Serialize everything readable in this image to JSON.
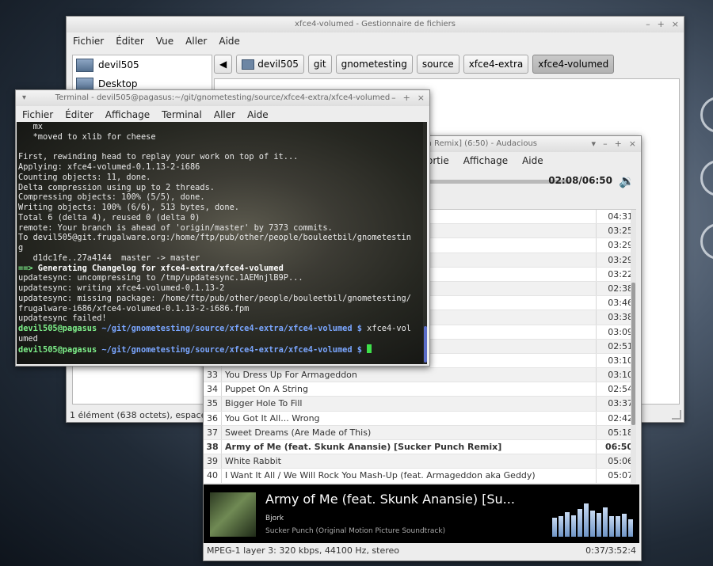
{
  "file_manager": {
    "title": "xfce4-volumed - Gestionnaire de fichiers",
    "menu": [
      "Fichier",
      "Éditer",
      "Vue",
      "Aller",
      "Aide"
    ],
    "side_items": [
      "devil505",
      "Desktop"
    ],
    "path": [
      "devil505",
      "git",
      "gnometesting",
      "source",
      "xfce4-extra",
      "xfce4-volumed"
    ],
    "status": "1 élément (638 octets), espace lib"
  },
  "terminal": {
    "title": "Terminal - devil505@pagasus:~/git/gnometesting/source/xfce4-extra/xfce4-volumed",
    "menu": [
      "Fichier",
      "Éditer",
      "Affichage",
      "Terminal",
      "Aller",
      "Aide"
    ],
    "lines": {
      "l1": "   mx",
      "l2": "   *moved to xlib for cheese",
      "l3": "",
      "l4": "First, rewinding head to replay your work on top of it...",
      "l5": "Applying: xfce4-volumed-0.1.13-2-i686",
      "l6": "Counting objects: 11, done.",
      "l7": "Delta compression using up to 2 threads.",
      "l8": "Compressing objects: 100% (5/5), done.",
      "l9": "Writing objects: 100% (6/6), 513 bytes, done.",
      "l10": "Total 6 (delta 4), reused 0 (delta 0)",
      "l11": "remote: Your branch is ahead of 'origin/master' by 7373 commits.",
      "l12": "To devil505@git.frugalware.org:/home/ftp/pub/other/people/bouleetbil/gnometestin",
      "l13": "g",
      "l14": "   d1dc1fe..27a4144  master -> master",
      "l15_arrow": "==>",
      "l15_text": " Generating Changelog for xfce4-extra/xfce4-volumed",
      "l16": "updatesync: uncompressing to /tmp/updatesync.1AEMnjlB9P...",
      "l17": "updatesync: writing xfce4-volumed-0.1.13-2",
      "l18": "updatesync: missing package: /home/ftp/pub/other/people/bouleetbil/gnometesting/",
      "l19": "frugalware-i686/xfce4-volumed-0.1.13-2-i686.fpm",
      "l20": "updatesync failed!",
      "p1_user": "devil505@pagasus",
      "p1_path": " ~/git/gnometesting/source/xfce4-extra/xfce4-volumed $",
      "p1_cmd": " xfce4-vol",
      "l22": "umed",
      "p2_user": "devil505@pagasus",
      "p2_path": " ~/git/gnometesting/source/xfce4-extra/xfce4-volumed $"
    }
  },
  "audacious": {
    "title": "ch Remix] (6:50) - Audacious",
    "menu": [
      "ortie",
      "Affichage",
      "Aide"
    ],
    "time": "02:08/06:50",
    "seek_fraction": 0.31,
    "hidden_durations": [
      "04:31",
      "03:25",
      "03:29",
      "03:29",
      "03:22",
      "02:38",
      "03:46",
      "03:38",
      "03:09",
      "02:51",
      "03:10"
    ],
    "playlist": [
      {
        "n": "33",
        "title": "You Dress Up For Armageddon",
        "dur": "03:10"
      },
      {
        "n": "34",
        "title": "Puppet On A String",
        "dur": "02:54"
      },
      {
        "n": "35",
        "title": "Bigger Hole To Fill",
        "dur": "03:37"
      },
      {
        "n": "36",
        "title": "You Got It All... Wrong",
        "dur": "02:42"
      },
      {
        "n": "37",
        "title": "Sweet Dreams (Are Made of This)",
        "dur": "05:18"
      },
      {
        "n": "38",
        "title": "Army of Me (feat. Skunk Anansie) [Sucker Punch Remix]",
        "dur": "06:50"
      },
      {
        "n": "39",
        "title": "White Rabbit",
        "dur": "05:06"
      },
      {
        "n": "40",
        "title": "I Want It All / We Will Rock You Mash-Up (feat. Armageddon aka Geddy)",
        "dur": "05:07"
      }
    ],
    "now_playing": {
      "title": "Army of Me (feat. Skunk Anansie) [Su...",
      "artist": "Bjork",
      "album": "Sucker Punch (Original Motion Picture Soundtrack)"
    },
    "status_left": "MPEG-1 layer 3: 320 kbps, 44100 Hz, stereo",
    "status_right": "0:37/3:52:4",
    "visualizer": [
      0.55,
      0.6,
      0.7,
      0.62,
      0.8,
      0.95,
      0.75,
      0.68,
      0.85,
      0.6,
      0.58,
      0.66,
      0.5
    ]
  }
}
